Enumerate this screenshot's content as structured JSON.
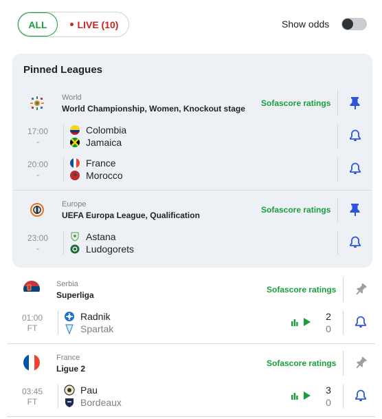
{
  "filters": {
    "all_label": "ALL",
    "live_label": "LIVE (10)",
    "show_odds_label": "Show odds",
    "show_odds_on": false
  },
  "colors": {
    "accent": "#1a9e3c",
    "live": "#c7241e",
    "bell": "#2e55d8",
    "pinned_bg": "#edf1f6"
  },
  "pinned": {
    "title": "Pinned Leagues",
    "leagues": [
      {
        "country": "World",
        "name": "World Championship, Women, Knockout stage",
        "ratings_label": "Sofascore ratings",
        "icon": "world-championship-women-logo",
        "matches": [
          {
            "time": "17:00",
            "status": "-",
            "home": "Colombia",
            "away": "Jamaica"
          },
          {
            "time": "20:00",
            "status": "-",
            "home": "France",
            "away": "Morocco"
          }
        ]
      },
      {
        "country": "Europe",
        "name": "UEFA Europa League, Qualification",
        "ratings_label": "Sofascore ratings",
        "icon": "europa-league-logo",
        "matches": [
          {
            "time": "23:00",
            "status": "-",
            "home": "Astana",
            "away": "Ludogorets"
          }
        ]
      }
    ]
  },
  "leagues": [
    {
      "country": "Serbia",
      "name": "Superliga",
      "ratings_label": "Sofascore ratings",
      "icon": "serbia-flag",
      "matches": [
        {
          "time": "01:00",
          "status": "FT",
          "home": "Radnik",
          "away": "Spartak",
          "home_score": "2",
          "away_score": "0"
        }
      ]
    },
    {
      "country": "France",
      "name": "Ligue 2",
      "ratings_label": "Sofascore ratings",
      "icon": "france-flag",
      "matches": [
        {
          "time": "03:45",
          "status": "FT",
          "home": "Pau",
          "away": "Bordeaux",
          "home_score": "3",
          "away_score": "0"
        }
      ]
    }
  ]
}
